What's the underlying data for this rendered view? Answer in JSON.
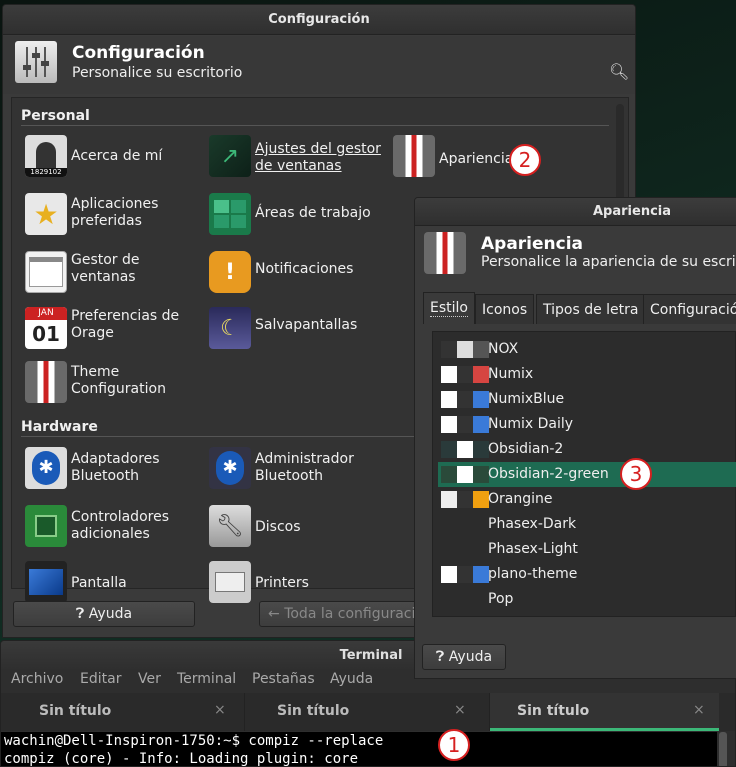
{
  "settings_window": {
    "title": "Configuración",
    "header_title": "Configuración",
    "header_subtitle": "Personalice su escritorio",
    "personal_label": "Personal",
    "hardware_label": "Hardware",
    "personal_items": [
      "Acerca de mí",
      "Ajustes del gestor de ventanas",
      "Apariencia",
      "Aplicaciones preferidas",
      "Áreas de trabajo",
      "Gestor de ventanas",
      "Notificaciones",
      "Preferencias de Orage",
      "Salvapantallas",
      "Theme Configuration"
    ],
    "about_badge_number": "1829102",
    "orage_month": "JAN",
    "orage_day": "01",
    "hardware_items": [
      "Adaptadores Bluetooth",
      "Administrador Bluetooth",
      "Controladores adicionales",
      "Discos",
      "Pantalla",
      "Printers"
    ],
    "help_label": "Ayuda",
    "all_settings_label": "Toda la configuració"
  },
  "appearance_window": {
    "title": "Apariencia",
    "header_title": "Apariencia",
    "header_subtitle": "Personalice la apariencia de su escrito",
    "tabs": [
      "Estilo",
      "Iconos",
      "Tipos de letra",
      "Configuració"
    ],
    "themes": [
      "NOX",
      "Numix",
      "NumixBlue",
      "Numix Daily",
      "Obsidian-2",
      "Obsidian-2-green",
      "Orangine",
      "Phasex-Dark",
      "Phasex-Light",
      "plano-theme",
      "Pop"
    ],
    "selected_theme": "Obsidian-2-green",
    "help_label": "Ayuda"
  },
  "terminal": {
    "title": "Terminal",
    "menu": [
      "Archivo",
      "Editar",
      "Ver",
      "Terminal",
      "Pestañas",
      "Ayuda"
    ],
    "tabs": [
      "Sin título",
      "Sin título",
      "Sin título"
    ],
    "lines": [
      "wachin@Dell-Inspiron-1750:~$ compiz --replace",
      "compiz (core) - Info: Loading plugin: core"
    ]
  },
  "annotations": [
    "1",
    "2",
    "3"
  ],
  "colors": {
    "selected_row": "#1e6b52",
    "accent_green": "#3cb878",
    "badge_red": "#d62020"
  }
}
